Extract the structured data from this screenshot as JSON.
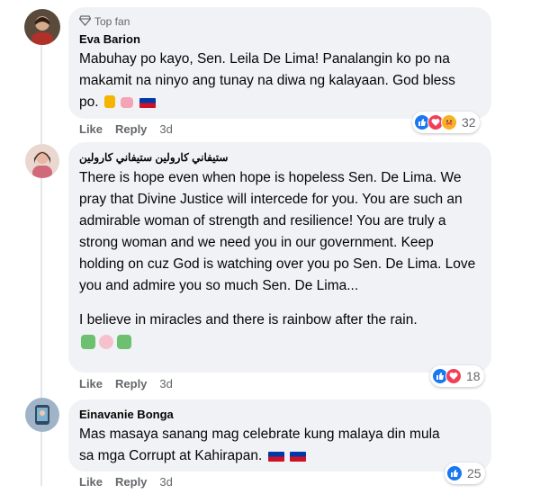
{
  "comments": [
    {
      "badge": "Top fan",
      "author": "Eva Barion",
      "text": "Mabuhay po kayo, Sen. Leila De Lima! Panalangin ko po na makamit na ninyo ang tunay na diwa ng kalayaan. God bless po.",
      "like_label": "Like",
      "reply_label": "Reply",
      "time": "3d",
      "reaction_count": "32"
    },
    {
      "author": "ستيفاني كارولين ستيفاني كارولين",
      "paragraphs": [
        "There is hope even when hope is hopeless Sen. De Lima. We pray that Divine Justice will intercede for you. You are such an admirable woman of strength and resilience! You are truly a strong woman and we need you in our government. Keep holding on cuz God is watching over you po Sen. De Lima. Love you and admire you so much Sen. De Lima...",
        "I believe in miracles and there is rainbow after the rain."
      ],
      "like_label": "Like",
      "reply_label": "Reply",
      "time": "3d",
      "reaction_count": "18"
    },
    {
      "author": "Einavanie Bonga",
      "text": "Mas masaya sanang mag celebrate kung malaya din mula sa mga Corrupt at Kahirapan.",
      "like_label": "Like",
      "reply_label": "Reply",
      "time": "3d",
      "reaction_count": "25"
    }
  ],
  "colors": {
    "bubble": "#f0f2f5",
    "like": "#1877f2",
    "love": "#f33e58",
    "care": "#f7b125",
    "meta": "#65676b"
  }
}
